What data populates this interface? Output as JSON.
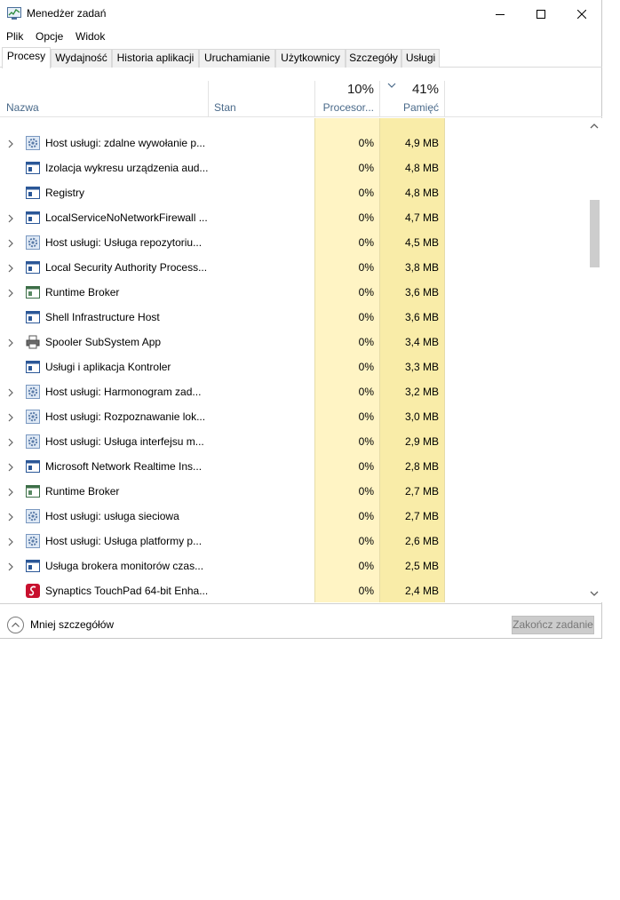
{
  "window": {
    "title": "Menedżer zadań"
  },
  "menu": [
    "Plik",
    "Opcje",
    "Widok"
  ],
  "tabs": [
    "Procesy",
    "Wydajność",
    "Historia aplikacji",
    "Uruchamianie",
    "Użytkownicy",
    "Szczegóły",
    "Usługi"
  ],
  "active_tab": 0,
  "columns": {
    "name": "Nazwa",
    "status": "Stan",
    "cpu_percent": "10%",
    "cpu_label": "Procesor...",
    "mem_percent": "41%",
    "mem_label": "Pamięć"
  },
  "rows": [
    {
      "name": "Host usługi: zdalne wywołanie p...",
      "cpu": "0%",
      "mem": "4,9 MB",
      "icon": "gear-icon",
      "expandable": true
    },
    {
      "name": "Izolacja wykresu urządzenia aud...",
      "cpu": "0%",
      "mem": "4,8 MB",
      "icon": "window-icon",
      "expandable": false
    },
    {
      "name": "Registry",
      "cpu": "0%",
      "mem": "4,8 MB",
      "icon": "window-icon",
      "expandable": false
    },
    {
      "name": "LocalServiceNoNetworkFirewall ...",
      "cpu": "0%",
      "mem": "4,7 MB",
      "icon": "window-icon",
      "expandable": true
    },
    {
      "name": "Host usługi: Usługa repozytoriu...",
      "cpu": "0%",
      "mem": "4,5 MB",
      "icon": "gear-icon",
      "expandable": true
    },
    {
      "name": "Local Security Authority Process...",
      "cpu": "0%",
      "mem": "3,8 MB",
      "icon": "window-icon",
      "expandable": true
    },
    {
      "name": "Runtime Broker",
      "cpu": "0%",
      "mem": "3,6 MB",
      "icon": "app-window-icon",
      "expandable": true
    },
    {
      "name": "Shell Infrastructure Host",
      "cpu": "0%",
      "mem": "3,6 MB",
      "icon": "window-icon",
      "expandable": false
    },
    {
      "name": "Spooler SubSystem App",
      "cpu": "0%",
      "mem": "3,4 MB",
      "icon": "printer-icon",
      "expandable": true
    },
    {
      "name": "Usługi i aplikacja Kontroler",
      "cpu": "0%",
      "mem": "3,3 MB",
      "icon": "window-icon",
      "expandable": false
    },
    {
      "name": "Host usługi: Harmonogram zad...",
      "cpu": "0%",
      "mem": "3,2 MB",
      "icon": "gear-icon",
      "expandable": true
    },
    {
      "name": "Host usługi: Rozpoznawanie lok...",
      "cpu": "0%",
      "mem": "3,0 MB",
      "icon": "gear-icon",
      "expandable": true
    },
    {
      "name": "Host usługi: Usługa interfejsu m...",
      "cpu": "0%",
      "mem": "2,9 MB",
      "icon": "gear-icon",
      "expandable": true
    },
    {
      "name": "Microsoft Network Realtime Ins...",
      "cpu": "0%",
      "mem": "2,8 MB",
      "icon": "window-icon",
      "expandable": true
    },
    {
      "name": "Runtime Broker",
      "cpu": "0%",
      "mem": "2,7 MB",
      "icon": "app-window-icon",
      "expandable": true
    },
    {
      "name": "Host usługi: usługa sieciowa",
      "cpu": "0%",
      "mem": "2,7 MB",
      "icon": "gear-icon",
      "expandable": true
    },
    {
      "name": "Host usługi: Usługa platformy p...",
      "cpu": "0%",
      "mem": "2,6 MB",
      "icon": "gear-icon",
      "expandable": true
    },
    {
      "name": "Usługa brokera monitorów czas...",
      "cpu": "0%",
      "mem": "2,5 MB",
      "icon": "window-icon",
      "expandable": true
    },
    {
      "name": "Synaptics TouchPad 64-bit Enha...",
      "cpu": "0%",
      "mem": "2,4 MB",
      "icon": "synaptics-icon",
      "expandable": false
    }
  ],
  "footer": {
    "less_details": "Mniej szczegółów",
    "end_task": "Zakończ zadanie"
  }
}
